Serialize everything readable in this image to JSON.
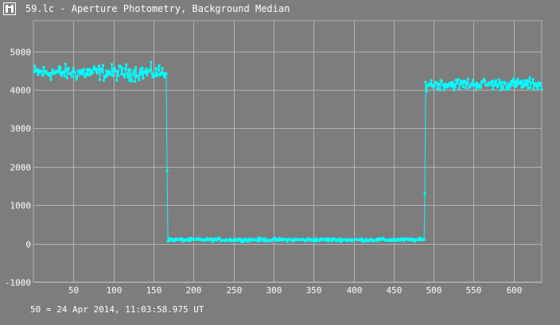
{
  "window": {
    "title": "59.lc - Aperture Photometry, Background Median"
  },
  "footer": {
    "time_reference": "50 = 24 Apr 2014, 11:03:58.975 UT"
  },
  "colors": {
    "background": "#7d7d7d",
    "grid": "#b4b4b4",
    "series": "#00ffff",
    "text": "#ffffff"
  },
  "chart_data": {
    "type": "line",
    "title": "Aperture Photometry, Background Median",
    "xlabel": "",
    "ylabel": "",
    "xlim": [
      0,
      635
    ],
    "ylim": [
      -1000,
      5800
    ],
    "x_ticks": [
      50,
      100,
      150,
      200,
      250,
      300,
      350,
      400,
      450,
      500,
      550,
      600
    ],
    "y_ticks": [
      -1000,
      0,
      1000,
      2000,
      3000,
      4000,
      5000
    ],
    "grid": true,
    "markers": true,
    "series": [
      {
        "name": "",
        "segments": [
          {
            "x_start": 1,
            "x_end": 166,
            "level": 4450,
            "spread": 300
          },
          {
            "x_start": 167,
            "x_end": 167,
            "level": 1900,
            "spread": 0
          },
          {
            "x_start": 168,
            "x_end": 488,
            "level": 100,
            "spread": 60
          },
          {
            "x_start": 489,
            "x_end": 489,
            "level": 1300,
            "spread": 0
          },
          {
            "x_start": 490,
            "x_end": 635,
            "level": 4150,
            "spread": 220
          }
        ]
      }
    ]
  }
}
